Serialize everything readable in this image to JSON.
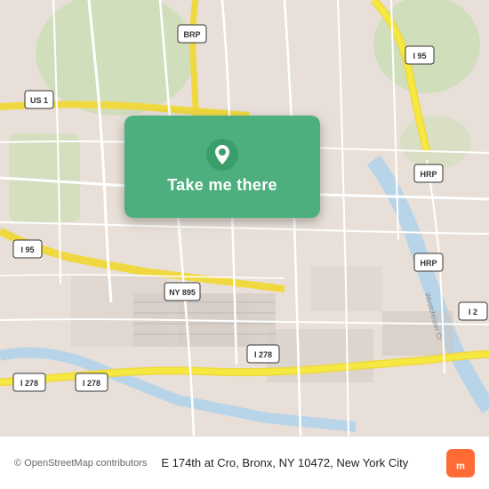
{
  "map": {
    "background_color": "#e8e0d8",
    "road_color_primary": "#f5e97a",
    "road_color_secondary": "#ffffff",
    "highway_labels": [
      "US 1",
      "I 95",
      "BRP",
      "HRP",
      "NY 895",
      "I 278",
      "I 278",
      "I 278"
    ],
    "card": {
      "background_color": "#4caf7d",
      "button_label": "Take me there",
      "pin_icon": "location-pin"
    }
  },
  "bottom_bar": {
    "copyright": "© OpenStreetMap contributors",
    "address": "E 174th at Cro, Bronx, NY 10472, New York City",
    "logo_text": "moovit"
  }
}
